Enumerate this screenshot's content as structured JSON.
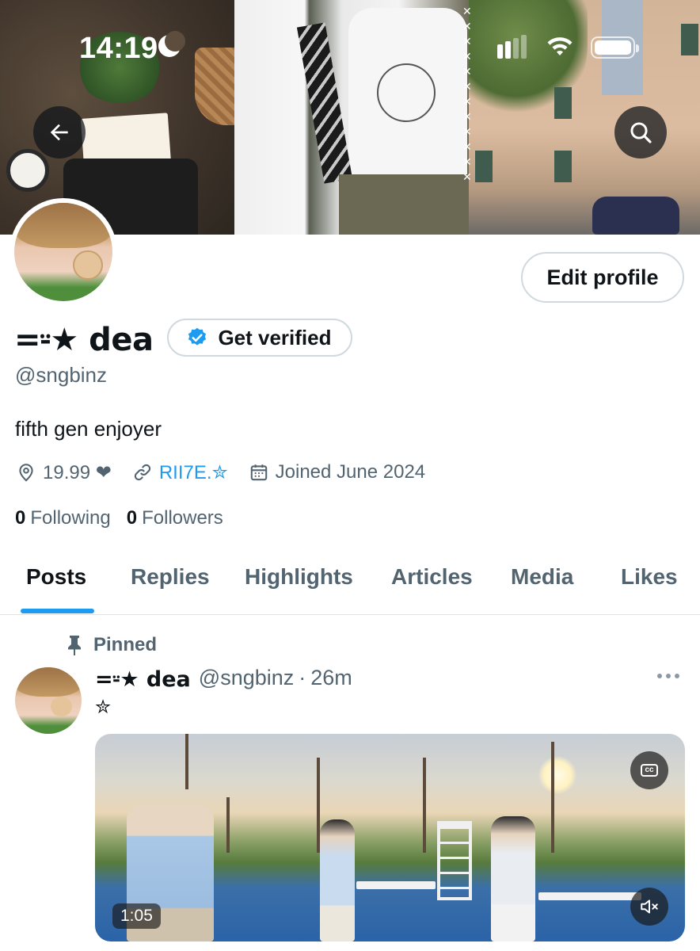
{
  "status_bar": {
    "time": "14:19",
    "icons": [
      "moon-icon",
      "signal-icon",
      "wifi-icon",
      "battery-icon"
    ]
  },
  "header": {
    "back_icon": "arrow-left-icon",
    "search_icon": "search-icon"
  },
  "profile": {
    "display_name": "=⸚★ dea",
    "verify_label": "Get verified",
    "handle": "@sngbinz",
    "bio": "fifth gen enjoyer",
    "edit_label": "Edit profile",
    "meta": {
      "location": "19.99 ❤",
      "link": "RII7E.✮",
      "joined": "Joined June 2024"
    },
    "following_count": "0",
    "following_label": "Following",
    "followers_count": "0",
    "followers_label": "Followers"
  },
  "tabs": [
    {
      "label": "Posts",
      "active": true
    },
    {
      "label": "Replies",
      "active": false
    },
    {
      "label": "Highlights",
      "active": false
    },
    {
      "label": "Articles",
      "active": false
    },
    {
      "label": "Media",
      "active": false
    },
    {
      "label": "Likes",
      "active": false
    }
  ],
  "post": {
    "pinned_label": "Pinned",
    "author_name": "=⸚★ dea",
    "author_handle": "@sngbinz",
    "separator": "·",
    "time": "26m",
    "text": "✮",
    "video": {
      "duration": "1:05",
      "cc_label": "cc"
    }
  },
  "colors": {
    "accent": "#1d9bf0",
    "text_primary": "#0f1419",
    "text_secondary": "#536471",
    "border": "#cfd9de"
  }
}
